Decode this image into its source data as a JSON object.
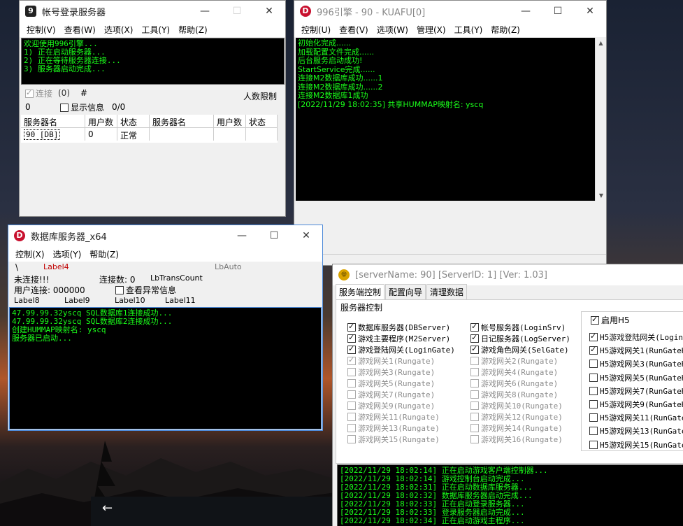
{
  "login_window": {
    "title": "帐号登录服务器",
    "menu": [
      "控制(V)",
      "查看(W)",
      "选项(X)",
      "工具(Y)",
      "帮助(Z)"
    ],
    "log": [
      "欢迎使用996引擎...",
      "1) 正在启动服务器...",
      "2) 正在等待服务器连接...",
      "3) 服务器启动完成..."
    ],
    "connect_label": "连接",
    "connect_count": "(0)",
    "hash": "#",
    "limit_label": "人数限制",
    "zero": "0",
    "show_info_label": "显示信息",
    "ratio": "0/0",
    "table_headers": [
      "服务器名",
      "用户数",
      "状态",
      "服务器名",
      "用户数",
      "状态"
    ],
    "table_row": [
      "90 [DB]",
      "0",
      "正常",
      "",
      "",
      ""
    ]
  },
  "kuafu_window": {
    "title": "996引擎 - 90 - KUAFU[0]",
    "menu": [
      "控制(U)",
      "查看(V)",
      "选项(W)",
      "管理(X)",
      "工具(Y)",
      "帮助(Z)"
    ],
    "log": [
      "初始化完成......",
      "加载配置文件完成......",
      "后台服务启动成功!",
      "StartService完成......",
      "连接M2数据库成功......1",
      "连接M2数据库成功......2",
      "连接M2数据库1成功",
      "[2022/11/29 18:02:35] 共享HUMMAP映射名: yscq"
    ]
  },
  "db_window": {
    "title": "数据库服务器_x64",
    "menu": [
      "控制(X)",
      "选项(Y)",
      "帮助(Z)"
    ],
    "backslash": "\\",
    "label4": "Label4",
    "lbauto": "LbAuto",
    "not_connected": "未连接!!!",
    "conn_count": "连接数: 0",
    "lbtrans": "LbTransCount",
    "user_conn": "用户连接: 000000",
    "check_abnormal": "查看异常信息",
    "labels": [
      "Label8",
      "Label9",
      "Label10",
      "Label11"
    ],
    "log": [
      "47.99.99.32yscq SQL数据库1连接成功...",
      "47.99.99.32yscq SQL数据库2连接成功...",
      "创建HUMMAP映射名: yscq",
      "服务器已启动..."
    ]
  },
  "control_window": {
    "title": "[serverName: 90] [ServerID: 1] [Ver:  1.03]",
    "tabs": [
      "服务端控制",
      "配置向导",
      "清理数据"
    ],
    "group_label": "服务器控制",
    "col1": [
      {
        "label": "数据库服务器(DBServer)",
        "checked": true,
        "disabled": false
      },
      {
        "label": "游戏主要程序(M2Server)",
        "checked": true,
        "disabled": false
      },
      {
        "label": "游戏登陆网关(LoginGate)",
        "checked": true,
        "disabled": false
      },
      {
        "label": "游戏网关1(Rungate)",
        "checked": true,
        "disabled": true
      },
      {
        "label": "游戏网关3(Rungate)",
        "checked": false,
        "disabled": true
      },
      {
        "label": "游戏网关5(Rungate)",
        "checked": false,
        "disabled": true
      },
      {
        "label": "游戏网关7(Rungate)",
        "checked": false,
        "disabled": true
      },
      {
        "label": "游戏网关9(Rungate)",
        "checked": false,
        "disabled": true
      },
      {
        "label": "游戏网关11(Rungate)",
        "checked": false,
        "disabled": true
      },
      {
        "label": "游戏网关13(Rungate)",
        "checked": false,
        "disabled": true
      },
      {
        "label": "游戏网关15(Rungate)",
        "checked": false,
        "disabled": true
      }
    ],
    "col2": [
      {
        "label": "帐号服务器(LoginSrv)",
        "checked": true,
        "disabled": false
      },
      {
        "label": "日记服务器(LogServer)",
        "checked": true,
        "disabled": false
      },
      {
        "label": "游戏角色网关(SelGate)",
        "checked": true,
        "disabled": false
      },
      {
        "label": "游戏网关2(Rungate)",
        "checked": false,
        "disabled": true
      },
      {
        "label": "游戏网关4(Rungate)",
        "checked": false,
        "disabled": true
      },
      {
        "label": "游戏网关6(Rungate)",
        "checked": false,
        "disabled": true
      },
      {
        "label": "游戏网关8(Rungate)",
        "checked": false,
        "disabled": true
      },
      {
        "label": "游戏网关10(Rungate)",
        "checked": false,
        "disabled": true
      },
      {
        "label": "游戏网关12(Rungate)",
        "checked": false,
        "disabled": true
      },
      {
        "label": "游戏网关14(Rungate)",
        "checked": false,
        "disabled": true
      },
      {
        "label": "游戏网关16(Rungate)",
        "checked": false,
        "disabled": true
      }
    ],
    "h5_enable": "启用H5",
    "col3": [
      {
        "label": "H5游戏登陆网关(Login",
        "checked": true
      },
      {
        "label": "H5游戏网关1(RunGateH",
        "checked": true
      },
      {
        "label": "H5游戏网关3(RunGateH",
        "checked": false
      },
      {
        "label": "H5游戏网关5(RunGateH",
        "checked": false
      },
      {
        "label": "H5游戏网关7(RunGateH",
        "checked": false
      },
      {
        "label": "H5游戏网关9(RunGateH",
        "checked": false
      },
      {
        "label": "H5游戏网关11(RunGate",
        "checked": false
      },
      {
        "label": "H5游戏网关13(RunGate",
        "checked": false
      },
      {
        "label": "H5游戏网关15(RunGate",
        "checked": false
      }
    ],
    "log": [
      "[2022/11/29 18:02:14] 正在启动游戏客户端控制器...",
      "[2022/11/29 18:02:14] 游戏控制台启动完成...",
      "[2022/11/29 18:02:31] 正在启动数据库服务器...",
      "[2022/11/29 18:02:32] 数据库服务器启动完成...",
      "[2022/11/29 18:02:33] 正在启动登录服务器...",
      "[2022/11/29 18:02:33] 登录服务器启动完成...",
      "[2022/11/29 18:02:34] 正在启动游戏主程序..."
    ]
  },
  "taskbar": {
    "back_arrow": "←"
  },
  "colors": {
    "console_bg": "#000000",
    "console_text": "#1aff1a",
    "app_icon": "#c8102e"
  }
}
